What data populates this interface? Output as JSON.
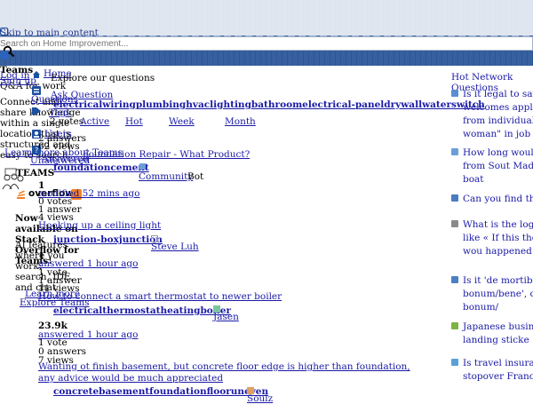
{
  "header": {
    "skip_link": "Skip to main content",
    "search_placeholder": "Search on Home Improvement..."
  },
  "sidebar": {
    "teams_heading": "Teams",
    "teams_line1": "Log in",
    "teams_line2": "Q&A for work",
    "signup": "Sign up",
    "teams_desc": "Connect and share knowledge within a single location that is structured and easy to search.",
    "learn_more": "Learn more about Teams",
    "nav": {
      "home": "Home",
      "questions": "Questions",
      "tags": "Tags",
      "users": "Users",
      "unanswered": "Unanswered"
    },
    "teams_label": "TEAMS",
    "teams_badge": "overflow",
    "teams_now": "Now available on Stack Overflow for Teams!",
    "teams_ai": "AI features where you work: search, IDE, and chat.",
    "learn_more2": "Learn more",
    "explore_teams": "Explore Teams"
  },
  "main": {
    "heading": "Explore our questions",
    "ask_button": "Ask Question",
    "tag_header": "electricalwiringplumbinghvaclightingbathroomelectrical-paneldrywallwaterswitch",
    "filter_tabs": [
      "Active",
      "Hot",
      "Week",
      "Month"
    ],
    "filter_lead": "2 votes",
    "questions": [
      {
        "stats_votes": "2 answers",
        "stats_views": "62 views",
        "state": "Answered",
        "title": "Foundation Repair - What Product?",
        "tags": "foundationcement",
        "user": "Community",
        "user_suffix": "Bot",
        "rep": "1",
        "time": "modified 52 mins ago",
        "votes": "0 votes",
        "answers": "1 answer",
        "views": "4 views"
      },
      {
        "title": "Hooking up a ceiling light",
        "tags": "junction-boxjunction",
        "user": "Steve Luh",
        "rep": "1",
        "time": "answered 1 hour ago",
        "votes": "1 vote",
        "answers": "1 answer",
        "views": "11 views"
      },
      {
        "title": "How to connect a smart thermostat to newer boiler",
        "tags": "electricalthermostatheatingboiler",
        "user": "Jasen",
        "rep": "23.9k",
        "time": "answered 1 hour ago",
        "votes": "1 vote",
        "answers": "0 answers",
        "views": "7 views"
      },
      {
        "title": "Wanting ot finish basement, but concrete floor edge is higher than foundation, any advice would be much appreciated",
        "tags": "concretebasementfoundationflooruneven",
        "user": "Soulz"
      }
    ]
  },
  "hnq": {
    "title": "Hot Network Questions",
    "items": [
      {
        "text": "Is it legal to say welcomes applications from individuals who s woman\" in job po",
        "icon_color": "#5b8fd0"
      },
      {
        "text": "How long would travel from Sout Madeira by boat",
        "icon_color": "#6a9fd8"
      },
      {
        "text": "Can you find the",
        "icon_color": "#4a7cc0"
      },
      {
        "text": "What is the logic goes like « If this then event Y wou happened »",
        "icon_color": "#8a8a8a"
      },
      {
        "text": "Is it 'de mortibus bonum/bene', or nihil nisi bonum/",
        "icon_color": "#4c7fc4"
      },
      {
        "text": "Japanese busines for landing sticke",
        "icon_color": "#7cb342"
      },
      {
        "text": "Is travel insuran an hour stopover France",
        "icon_color": "#5aa0d8"
      }
    ]
  },
  "colors": {
    "link": "#1a1aa6",
    "header_blue": "#3b65a3"
  }
}
